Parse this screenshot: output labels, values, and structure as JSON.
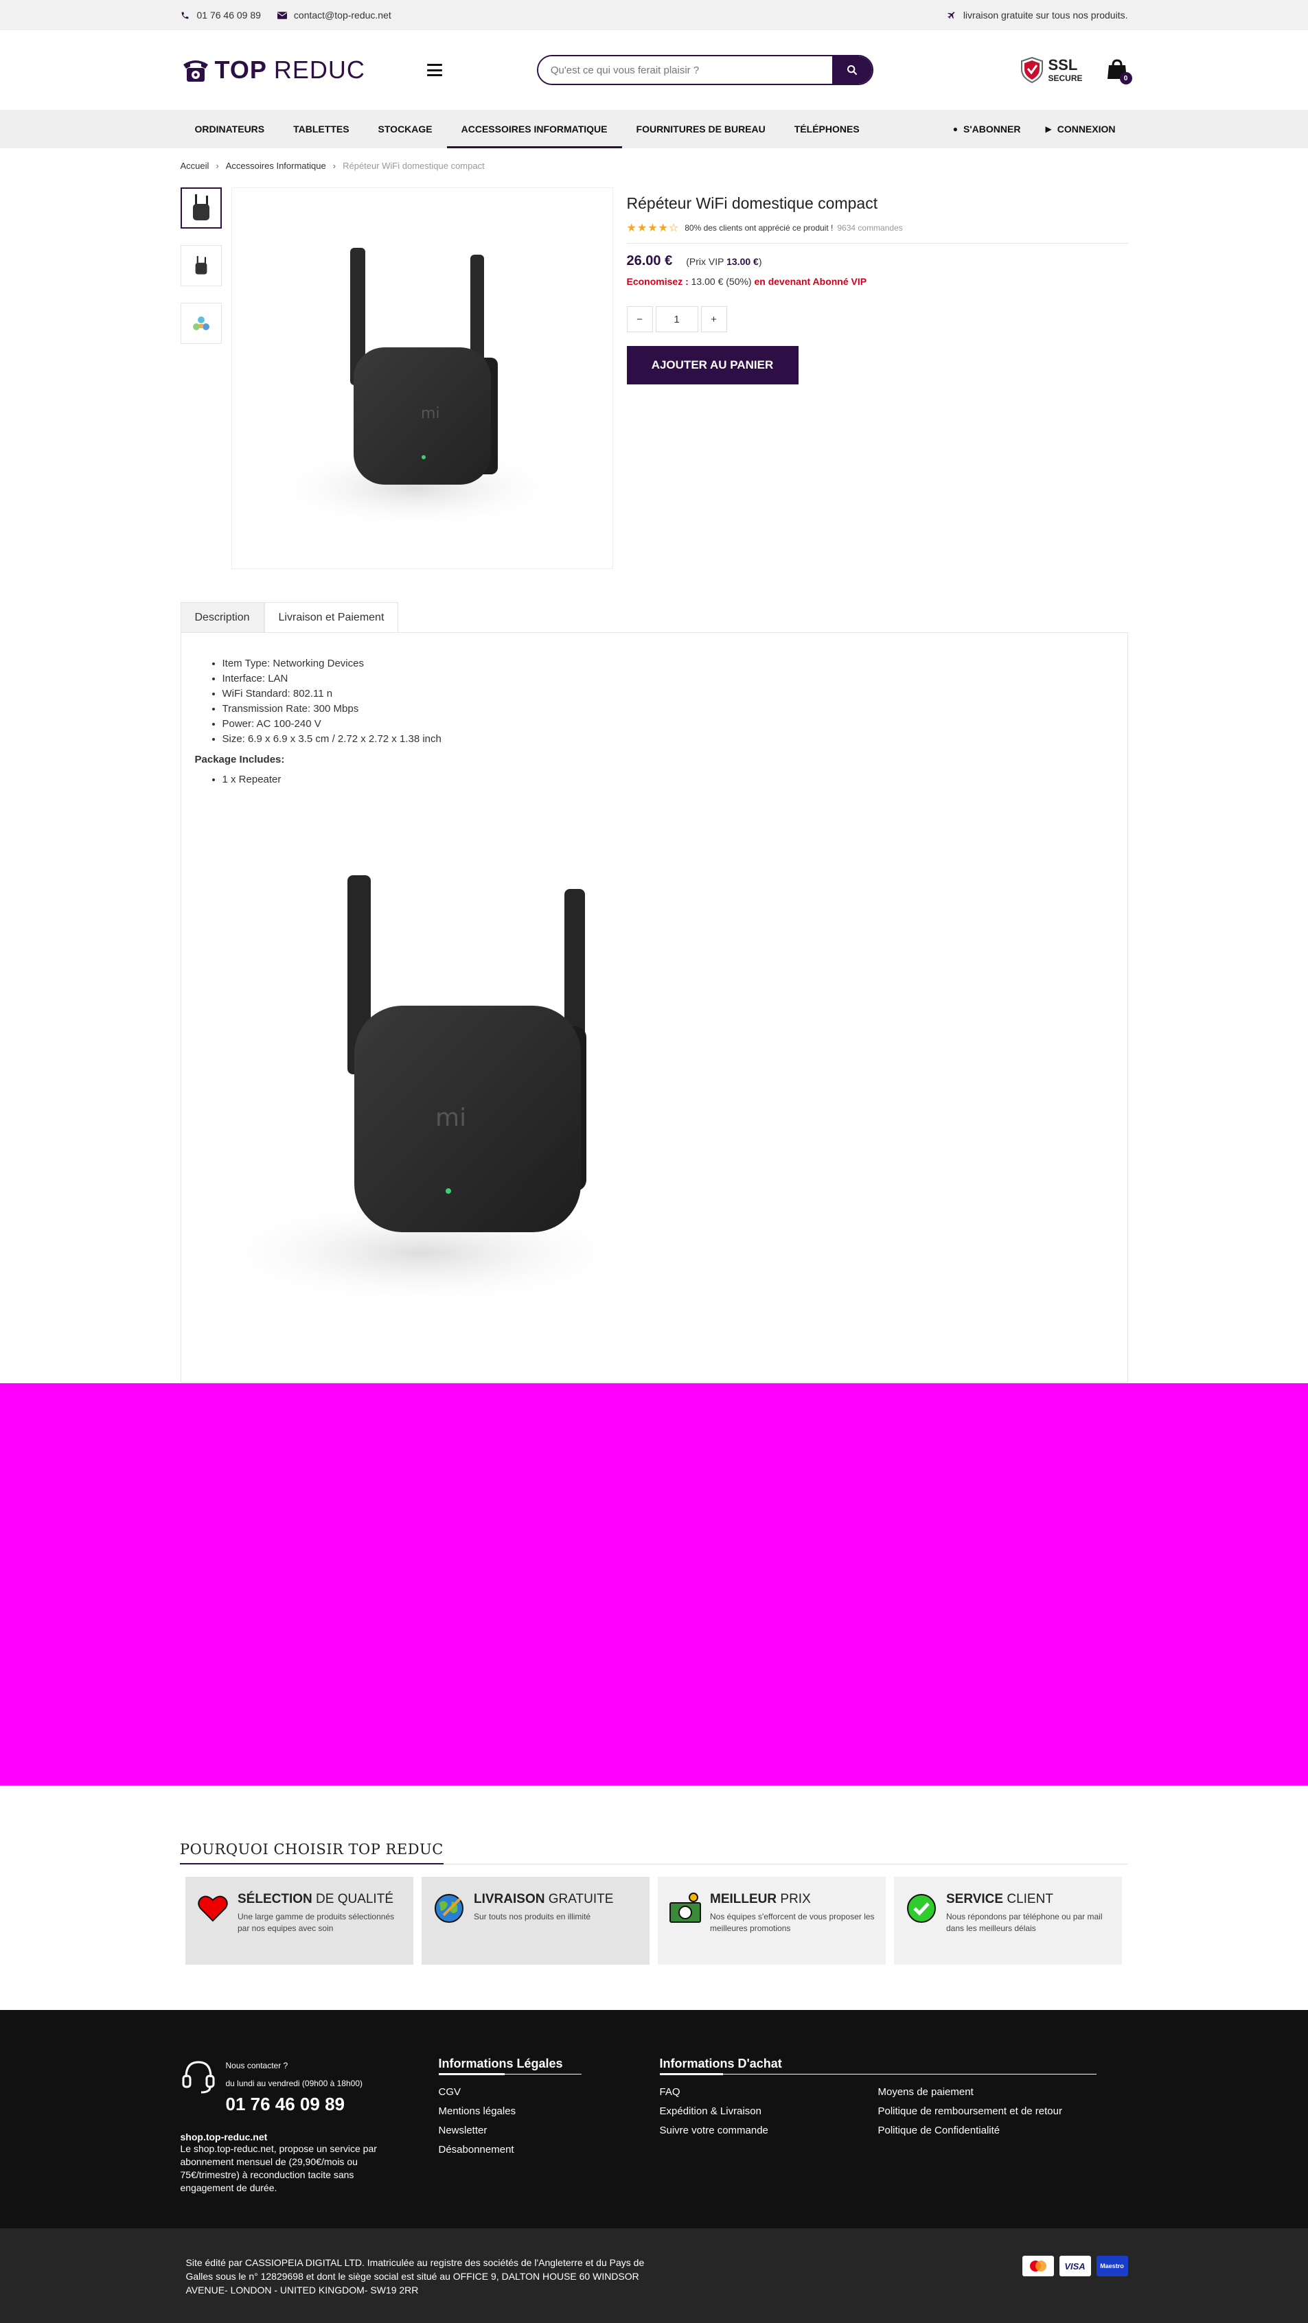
{
  "topbar": {
    "phone": "01 76 46 09 89",
    "email": "contact@top-reduc.net",
    "shipping": "livraison gratuite sur tous nos produits."
  },
  "header": {
    "logo_top": "TOP",
    "logo_reduc": "REDUC",
    "search_placeholder": "Qu'est ce qui vous ferait plaisir ?",
    "ssl_big": "SSL",
    "ssl_small": "SECURE",
    "cart_count": "0"
  },
  "nav": {
    "items": [
      "ORDINATEURS",
      "TABLETTES",
      "STOCKAGE",
      "ACCESSOIRES INFORMATIQUE",
      "FOURNITURES DE BUREAU",
      "TÉLÉPHONES"
    ],
    "active_index": 3,
    "subscribe": "S'ABONNER",
    "login": "CONNEXION"
  },
  "breadcrumb": {
    "home": "Accueil",
    "category": "Accessoires Informatique",
    "current": "Répéteur WiFi domestique compact"
  },
  "product": {
    "title": "Répéteur WiFi domestique compact",
    "rating_stars": 4,
    "rating_text": "80% des clients ont apprécié ce produit !",
    "orders": "9634 commandes",
    "price": "26.00 €",
    "vip_prefix": "(Prix VIP",
    "vip_price": "13.00 €",
    "vip_suffix": ")",
    "save_label": "Economisez :",
    "save_amount": "13.00 € (50%)",
    "save_suffix": "en devenant Abonné VIP",
    "qty_minus": "−",
    "qty": "1",
    "qty_plus": "+",
    "add_to_cart": "AJOUTER AU PANIER"
  },
  "tabs": {
    "description": "Description",
    "shipping": "Livraison et Paiement"
  },
  "description": {
    "specs": [
      "Item Type: Networking Devices",
      "Interface: LAN",
      "WiFi Standard: 802.11 n",
      "Transmission Rate: 300 Mbps",
      "Power: AC 100-240 V",
      "Size: 6.9 x 6.9 x 3.5 cm / 2.72 x 2.72 x 1.38 inch"
    ],
    "package_title": "Package Includes:",
    "package_items": [
      "1 x Repeater"
    ]
  },
  "why": {
    "title_prefix": "POURQUOI CHOISIR",
    "title_brand": "TOP REDUC",
    "cards": [
      {
        "bold": "SÉLECTION",
        "rest": "DE QUALITÉ",
        "desc": "Une large gamme de produits sélectionnés par nos equipes avec soin",
        "icon": "heart-icon"
      },
      {
        "bold": "LIVRAISON",
        "rest": "GRATUITE",
        "desc": "Sur touts nos produits en illimité",
        "icon": "globe-icon"
      },
      {
        "bold": "MEILLEUR",
        "rest": "PRIX",
        "desc": "Nos équipes s'efforcent de vous proposer les meilleures promotions",
        "icon": "money-icon"
      },
      {
        "bold": "SERVICE",
        "rest": "CLIENT",
        "desc": "Nous répondons par téléphone ou par mail dans les meilleurs délais",
        "icon": "check-icon"
      }
    ]
  },
  "footer": {
    "contact_label": "Nous contacter ?",
    "hours": "du lundi au vendredi (09h00 à 18h00)",
    "phone": "01 76 46 09 89",
    "site": "shop.top-reduc.net",
    "desc": "Le shop.top-reduc.net, propose un service par abonnement mensuel de (29,90€/mois ou 75€/trimestre) à reconduction tacite sans engagement de durée.",
    "legal_title": "Informations Légales",
    "legal_links": [
      "CGV",
      "Mentions légales",
      "Newsletter",
      "Désabonnement"
    ],
    "achat_title": "Informations D'achat",
    "achat_links_left": [
      "FAQ",
      "Expédition & Livraison",
      "Suivre votre commande"
    ],
    "achat_links_right": [
      "Moyens de paiement",
      "Politique de remboursement et de retour",
      "Politique de Confidentialité"
    ],
    "legal_text": "Site édité par CASSIOPEIA DIGITAL LTD. Imatriculée au registre des sociétés de l'Angleterre et du Pays de Galles sous le n° 12829698 et dont le siège social est situé au OFFICE 9, DALTON HOUSE 60 WINDSOR AVENUE- LONDON - UNITED KINGDOM- SW19 2RR",
    "payments": [
      "mastercard",
      "VISA",
      "Maestro"
    ]
  },
  "colors": {
    "brand": "#2e0f45",
    "ad_banner": "#ff00ff",
    "footer": "#111111",
    "accent_red": "#d0021b",
    "stars": "#f5a623"
  }
}
